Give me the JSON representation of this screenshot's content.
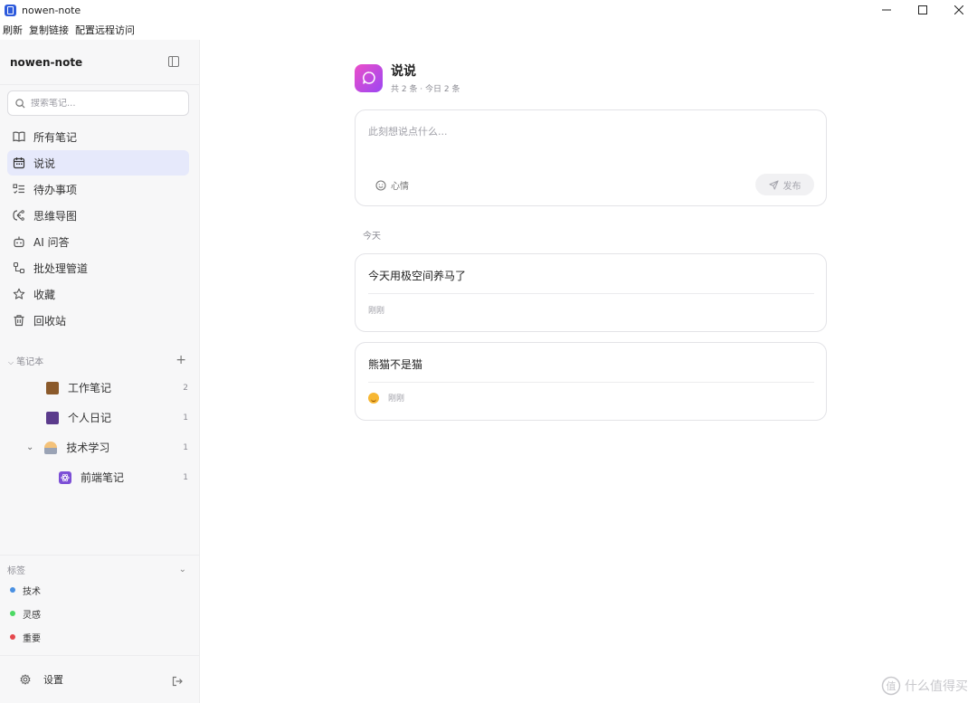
{
  "window": {
    "title": "nowen-note"
  },
  "menu": [
    "刷新",
    "复制链接",
    "配置远程访问"
  ],
  "sidebar": {
    "app_name": "nowen-note",
    "search_placeholder": "搜索笔记...",
    "nav": [
      {
        "label": "所有笔记",
        "icon": "book-icon"
      },
      {
        "label": "说说",
        "icon": "calendar-icon",
        "active": true
      },
      {
        "label": "待办事项",
        "icon": "list-check-icon"
      },
      {
        "label": "思维导图",
        "icon": "mindmap-icon"
      },
      {
        "label": "AI 问答",
        "icon": "robot-icon"
      },
      {
        "label": "批处理管道",
        "icon": "workflow-icon"
      },
      {
        "label": "收藏",
        "icon": "star-icon"
      },
      {
        "label": "回收站",
        "icon": "trash-icon"
      }
    ],
    "notebooks_header": "笔记本",
    "notebooks": [
      {
        "name": "工作笔记",
        "count": "2",
        "icon": "briefcase-icon"
      },
      {
        "name": "个人日记",
        "count": "1",
        "icon": "diary-icon"
      },
      {
        "name": "技术学习",
        "count": "1",
        "icon": "student-icon"
      },
      {
        "name": "前端笔记",
        "count": "1",
        "icon": "react-icon"
      }
    ],
    "tags_header": "标签",
    "tags": [
      {
        "name": "技术",
        "color": "#4a90e2"
      },
      {
        "name": "灵感",
        "color": "#4cd964"
      },
      {
        "name": "重要",
        "color": "#e5484d"
      }
    ],
    "settings_label": "设置"
  },
  "main": {
    "title": "说说",
    "subtitle": "共 2 条 · 今日 2 条",
    "composer_placeholder": "此刻想说点什么...",
    "mood_label": "心情",
    "publish_label": "发布",
    "date_group": "今天",
    "posts": [
      {
        "text": "今天用极空间养马了",
        "time": "刚刚",
        "has_mood": false
      },
      {
        "text": "熊猫不是猫",
        "time": "刚刚",
        "has_mood": true
      }
    ]
  },
  "watermark": "什么值得买"
}
